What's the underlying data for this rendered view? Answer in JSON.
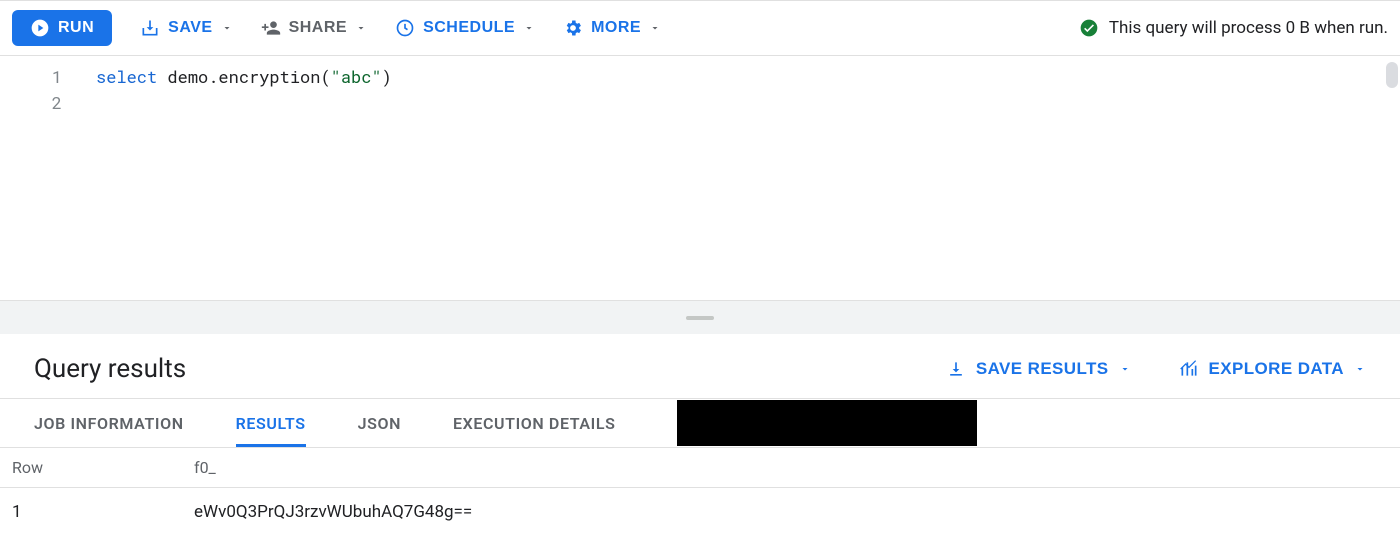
{
  "toolbar": {
    "run": "RUN",
    "save": "SAVE",
    "share": "SHARE",
    "schedule": "SCHEDULE",
    "more": "MORE"
  },
  "status": {
    "text": "This query will process 0 B when run."
  },
  "editor": {
    "lines": {
      "l1": "1",
      "l2": "2"
    },
    "code": {
      "keyword": "select",
      "mid": " demo.encryption(",
      "string": "\"abc\"",
      "end": ")"
    }
  },
  "results": {
    "title": "Query results",
    "save": "SAVE RESULTS",
    "explore": "EXPLORE DATA"
  },
  "tabs": {
    "job": "JOB INFORMATION",
    "results": "RESULTS",
    "json": "JSON",
    "exec": "EXECUTION DETAILS"
  },
  "table": {
    "head_row": "Row",
    "head_f0": "f0_",
    "rows": [
      {
        "n": "1",
        "f0": "eWv0Q3PrQJ3rzvWUbuhAQ7G48g=="
      }
    ]
  }
}
